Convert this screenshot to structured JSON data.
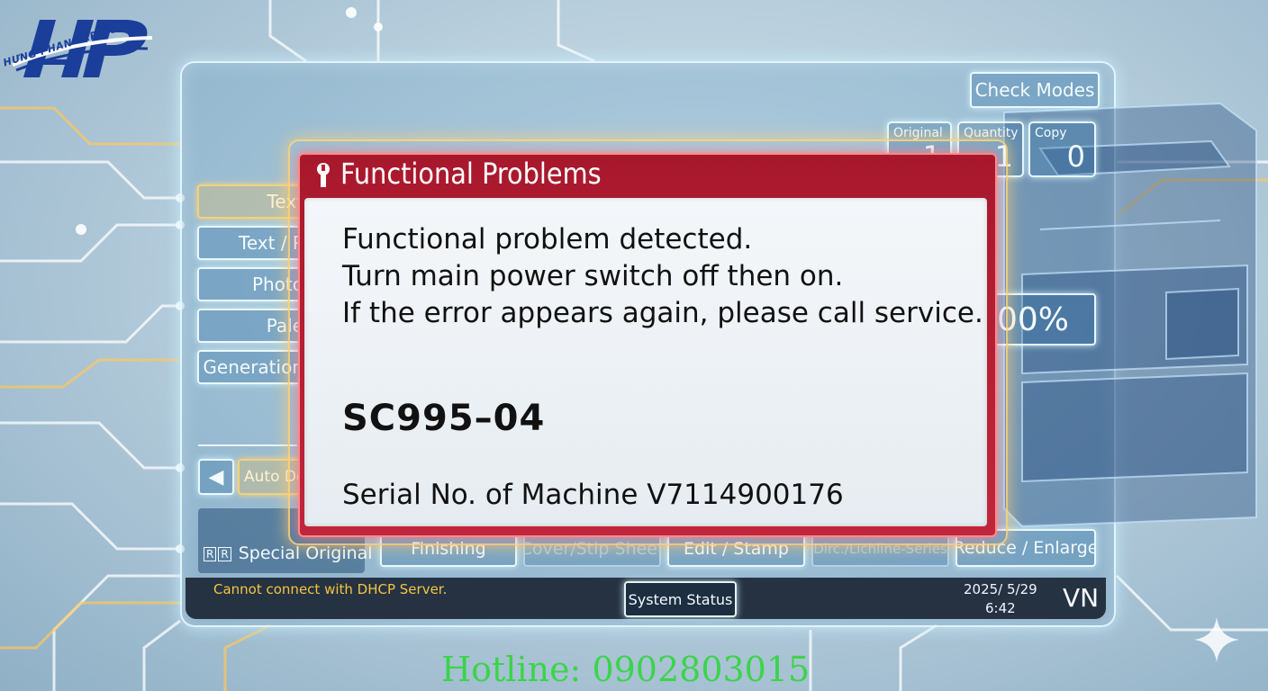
{
  "brand": {
    "logo_letters": "HP",
    "logo_text": "HƯNG PHAN SERVICES"
  },
  "top": {
    "check_modes": "Check Modes"
  },
  "counters": [
    {
      "label": "Original",
      "value": "1"
    },
    {
      "label": "Quantity",
      "value": "1"
    },
    {
      "label": "Copy",
      "value": "0"
    }
  ],
  "mode_buttons": [
    "Text",
    "Text / P",
    "Photo",
    "Pale",
    "Generation"
  ],
  "auto_density": {
    "arrow": "◀",
    "label": "Auto Der"
  },
  "zoom_value": "00%",
  "bottom_tabs": {
    "special_original": "Special Original",
    "finishing": "Finishing",
    "cover_slip": "Cover/Stip Sheet",
    "edit_stamp": "Edit / Stamp",
    "dirc": "Dirc./Lichline-Series",
    "reduce_enlarge": "Reduce / Enlarge"
  },
  "status": {
    "message": "Cannot connect with DHCP Server.",
    "system_status": "System Status",
    "date": "2025/ 5/29",
    "time": "6:42",
    "language": "VN"
  },
  "dialog": {
    "title": "Functional Problems",
    "lines": [
      "Functional problem detected.",
      "Turn main power switch off then on.",
      "If the error appears again, please call service."
    ],
    "code": "SC995–04",
    "serial": "Serial No. of Machine V7114900176"
  },
  "hotline": "Hotline: 0902803015",
  "colors": {
    "dialog_header": "#b81e33",
    "status_text": "#f4c542",
    "hotline": "#3bd44a"
  }
}
